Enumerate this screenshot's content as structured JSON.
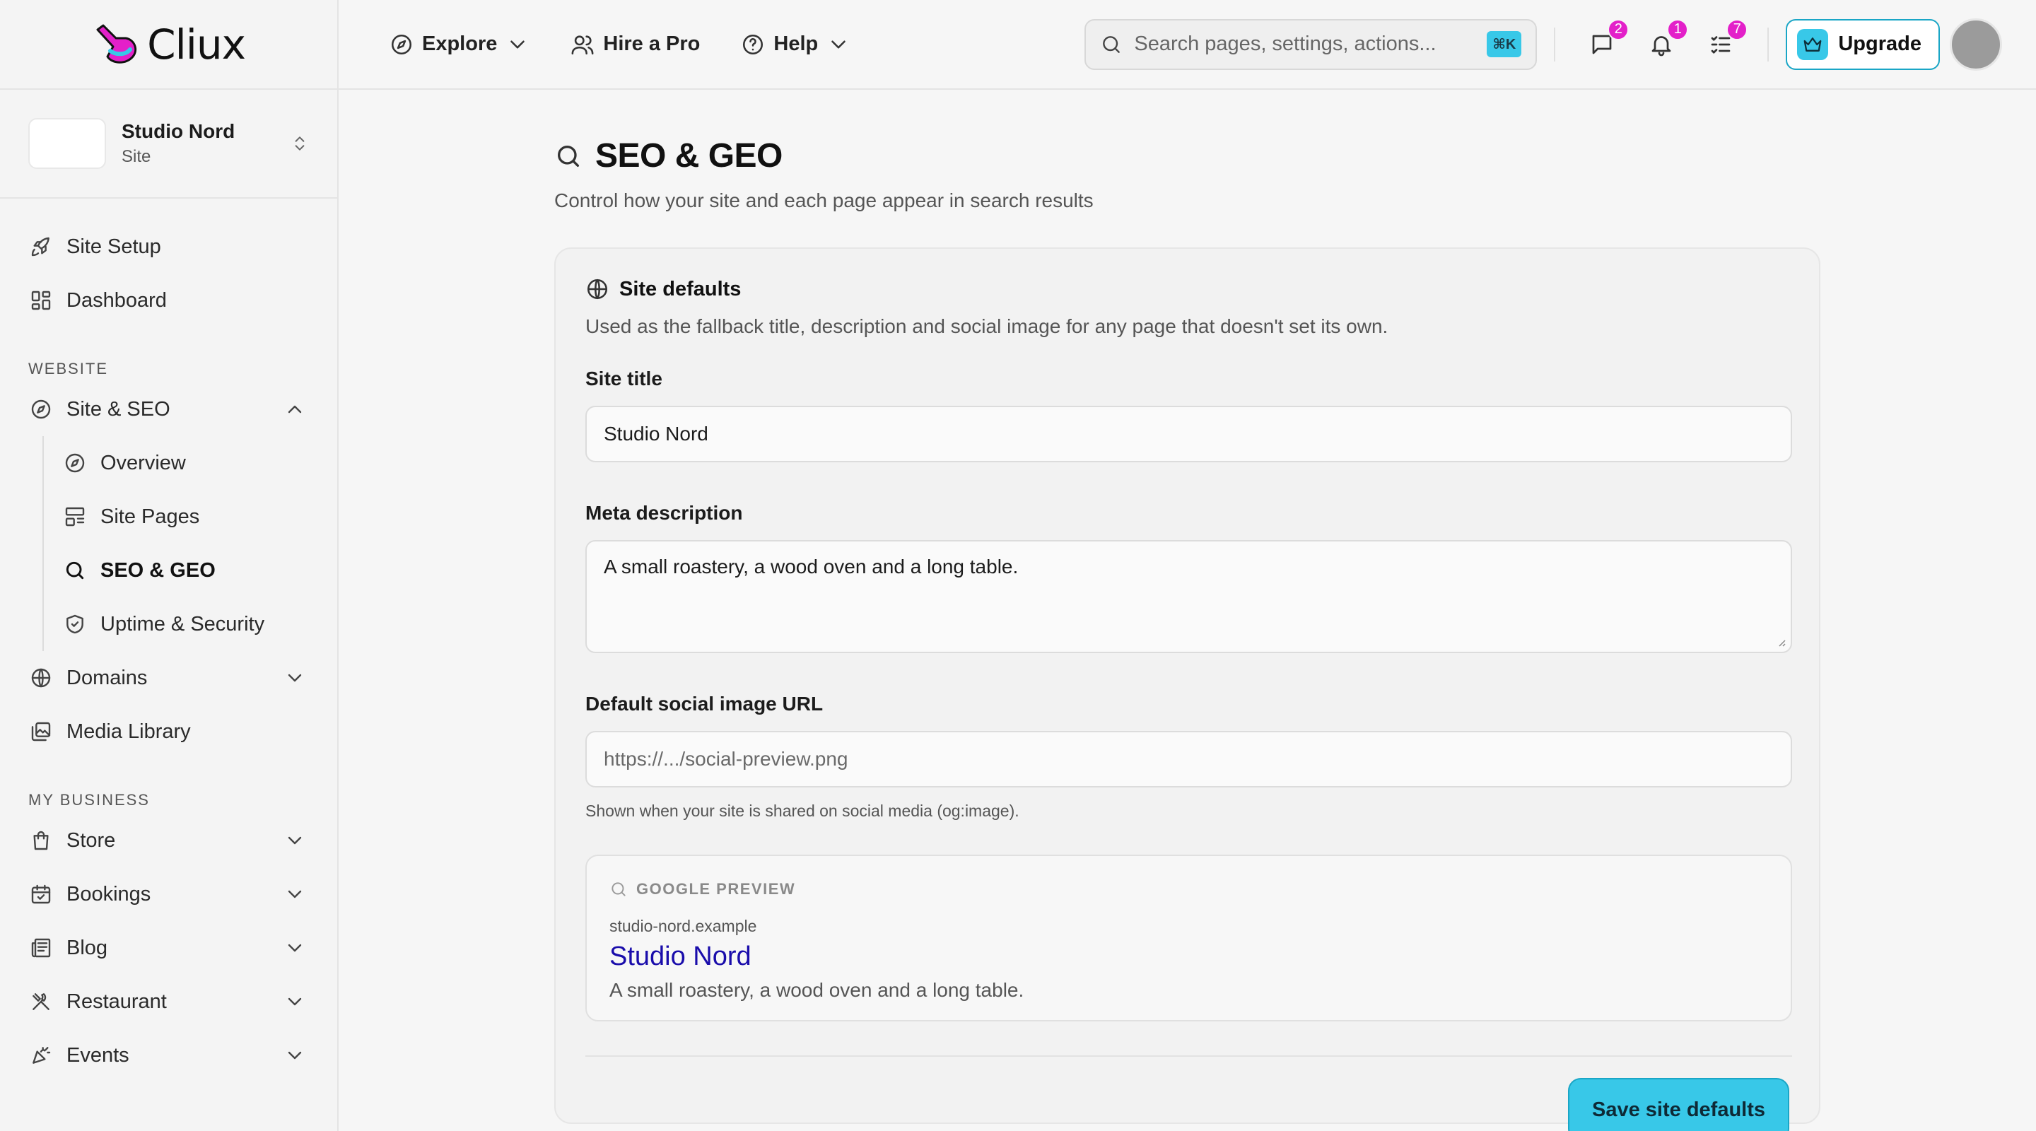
{
  "brand": {
    "name": "Cliux",
    "accent": "#38c8e8",
    "logo_color": "#e320c9"
  },
  "site": {
    "name": "Studio Nord",
    "kind": "Site"
  },
  "sidebar": {
    "top_items": [
      {
        "label": "Site Setup",
        "icon": "rocket-icon"
      },
      {
        "label": "Dashboard",
        "icon": "dashboard-icon"
      }
    ],
    "section_website": "WEBSITE",
    "site_seo": {
      "label": "Site & SEO",
      "icon": "compass-icon",
      "expanded": true
    },
    "site_seo_children": [
      {
        "label": "Overview",
        "icon": "compass-icon"
      },
      {
        "label": "Site Pages",
        "icon": "layout-icon"
      },
      {
        "label": "SEO & GEO",
        "icon": "search-icon",
        "active": true
      },
      {
        "label": "Uptime & Security",
        "icon": "shield-icon"
      }
    ],
    "domains": {
      "label": "Domains",
      "icon": "globe-icon"
    },
    "media": {
      "label": "Media Library",
      "icon": "media-icon"
    },
    "section_business": "MY BUSINESS",
    "business_items": [
      {
        "label": "Store",
        "icon": "bag-icon"
      },
      {
        "label": "Bookings",
        "icon": "calendar-icon"
      },
      {
        "label": "Blog",
        "icon": "newspaper-icon"
      },
      {
        "label": "Restaurant",
        "icon": "utensils-icon"
      },
      {
        "label": "Events",
        "icon": "party-icon"
      }
    ]
  },
  "topbar": {
    "explore": "Explore",
    "hire": "Hire a Pro",
    "help": "Help",
    "search_placeholder": "Search pages, settings, actions...",
    "search_shortcut": "⌘K",
    "messages_count": "2",
    "notifications_count": "1",
    "tasks_count": "7",
    "upgrade": "Upgrade"
  },
  "page": {
    "title": "SEO & GEO",
    "subtitle": "Control how your site and each page appear in search results"
  },
  "site_defaults": {
    "heading": "Site defaults",
    "description": "Used as the fallback title, description and social image for any page that doesn't set its own.",
    "site_title_label": "Site title",
    "site_title_value": "Studio Nord",
    "meta_label": "Meta description",
    "meta_value": "A small roastery, a wood oven and a long table.",
    "social_label": "Default social image URL",
    "social_placeholder": "https://.../social-preview.png",
    "social_hint": "Shown when your site is shared on social media (og:image).",
    "preview_label": "GOOGLE PREVIEW",
    "preview_url": "studio-nord.example",
    "preview_title": "Studio Nord",
    "preview_desc": "A small roastery, a wood oven and a long table.",
    "save_label": "Save site defaults"
  }
}
